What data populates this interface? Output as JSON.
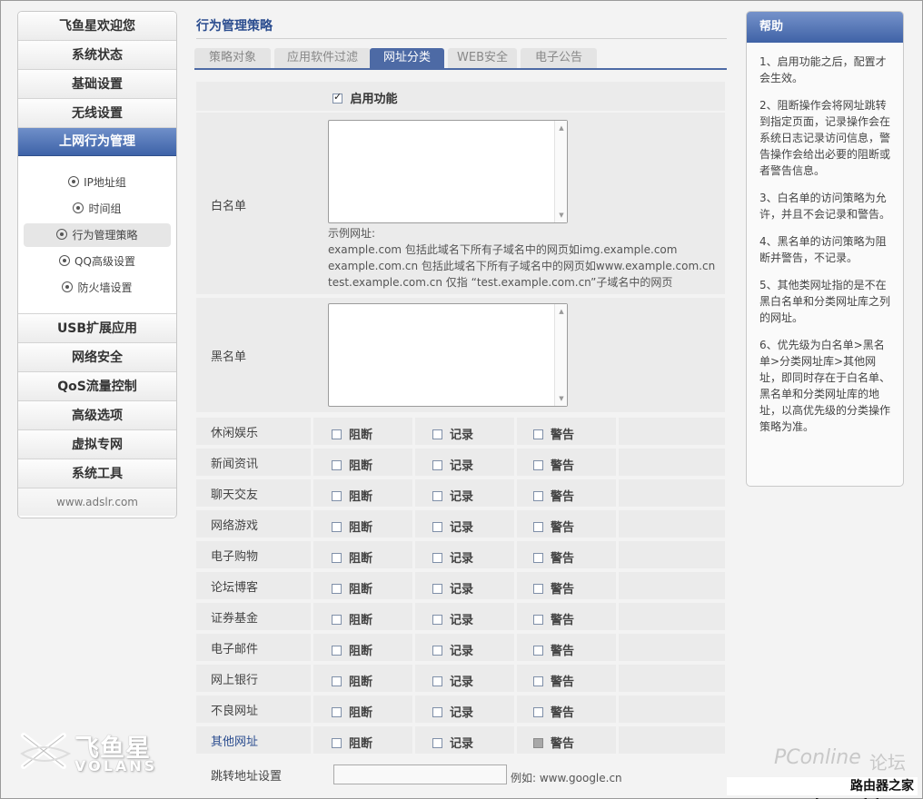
{
  "sidebar": {
    "top_items": [
      "飞鱼星欢迎您",
      "系统状态",
      "基础设置",
      "无线设置"
    ],
    "active_item": "上网行为管理",
    "sub_items": [
      "IP地址组",
      "时间组",
      "行为管理策略",
      "QQ高级设置",
      "防火墙设置"
    ],
    "bottom_items": [
      "USB扩展应用",
      "网络安全",
      "QoS流量控制",
      "高级选项",
      "虚拟专网",
      "系统工具"
    ],
    "footer": "www.adslr.com"
  },
  "logo": {
    "cn": "飞鱼星",
    "en": "VOLANS"
  },
  "main": {
    "title": "行为管理策略",
    "tabs": [
      "策略对象",
      "应用软件过滤",
      "网址分类",
      "WEB安全",
      "电子公告"
    ],
    "active_tab": "网址分类",
    "enable_label": "启用功能",
    "whitelist_label": "白名单",
    "examples": [
      "示例网址:",
      "example.com 包括此域名下所有子域名中的网页如img.example.com",
      "example.com.cn 包括此域名下所有子域名中的网页如www.example.com.cn",
      "test.example.com.cn 仅指 “test.example.com.cn”子域名中的网页"
    ],
    "blacklist_label": "黑名单",
    "option_labels": {
      "block": "阻断",
      "log": "记录",
      "warn": "警告"
    },
    "categories": [
      "休闲娱乐",
      "新闻资讯",
      "聊天交友",
      "网络游戏",
      "电子购物",
      "论坛博客",
      "证券基金",
      "电子邮件",
      "网上银行",
      "不良网址",
      "其他网址"
    ],
    "redirect_label": "跳转地址设置",
    "redirect_example": "例如: www.google.cn"
  },
  "help": {
    "title": "帮助",
    "paragraphs": [
      "1、启用功能之后，配置才会生效。",
      "2、阻断操作会将网址跳转到指定页面，记录操作会在系统日志记录访问信息，警告操作会给出必要的阻断或者警告信息。",
      "3、白名单的访问策略为允许，并且不会记录和警告。",
      "4、黑名单的访问策略为阻断并警告，不记录。",
      "5、其他类网址指的是不在黑白名单和分类网址库之列的网址。",
      "6、优先级为白名单>黑名单>分类网址库>其他网址，即同时存在于白名单、黑名单和分类网址库的地址，以高优先级的分类操作策略为准。"
    ]
  },
  "watermarks": {
    "pconline": "PConline",
    "forum": "论坛",
    "site": "路由器之家www.luyouqizj.com"
  }
}
